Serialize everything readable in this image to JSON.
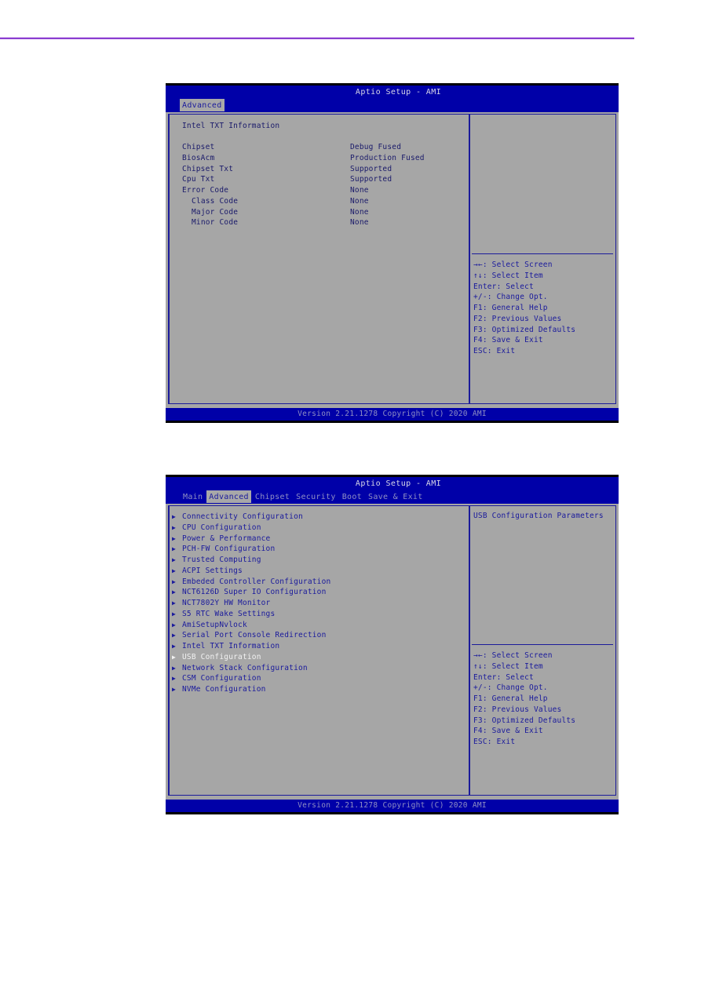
{
  "screens": [
    {
      "title": "Aptio Setup - AMI",
      "tabs": [
        {
          "label": "Advanced",
          "active": true
        }
      ],
      "heading": "Intel TXT Information",
      "rows": [
        {
          "label": "Chipset",
          "value": "Debug Fused",
          "indent": false
        },
        {
          "label": "BiosAcm",
          "value": "Production Fused",
          "indent": false
        },
        {
          "label": "Chipset Txt",
          "value": "Supported",
          "indent": false
        },
        {
          "label": "Cpu Txt",
          "value": "Supported",
          "indent": false
        },
        {
          "label": "Error Code",
          "value": "None",
          "indent": false
        },
        {
          "label": "Class Code",
          "value": "None",
          "indent": true
        },
        {
          "label": "Major Code",
          "value": "None",
          "indent": true
        },
        {
          "label": "Minor Code",
          "value": "None",
          "indent": true
        }
      ],
      "help_description": "",
      "keys": [
        "→←: Select Screen",
        "↑↓: Select Item",
        "Enter: Select",
        "+/-: Change Opt.",
        "F1: General Help",
        "F2: Previous Values",
        "F3: Optimized Defaults",
        "F4: Save & Exit",
        "ESC: Exit"
      ],
      "footer": "Version 2.21.1278 Copyright (C) 2020 AMI"
    },
    {
      "title": "Aptio Setup - AMI",
      "tabs": [
        {
          "label": "Main",
          "active": false
        },
        {
          "label": "Advanced",
          "active": true
        },
        {
          "label": "Chipset",
          "active": false
        },
        {
          "label": "Security",
          "active": false
        },
        {
          "label": "Boot",
          "active": false
        },
        {
          "label": "Save & Exit",
          "active": false
        }
      ],
      "menu": [
        {
          "label": "Connectivity Configuration",
          "selected": false
        },
        {
          "label": "CPU Configuration",
          "selected": false
        },
        {
          "label": "Power & Performance",
          "selected": false
        },
        {
          "label": "PCH-FW Configuration",
          "selected": false
        },
        {
          "label": "Trusted Computing",
          "selected": false
        },
        {
          "label": "ACPI Settings",
          "selected": false
        },
        {
          "label": "Embeded Controller Configuration",
          "selected": false
        },
        {
          "label": "NCT6126D Super IO Configuration",
          "selected": false
        },
        {
          "label": "NCT7802Y HW Monitor",
          "selected": false
        },
        {
          "label": "S5 RTC Wake Settings",
          "selected": false
        },
        {
          "label": "AmiSetupNvlock",
          "selected": false
        },
        {
          "label": "Serial Port Console Redirection",
          "selected": false
        },
        {
          "label": "Intel TXT Information",
          "selected": false
        },
        {
          "label": "USB Configuration",
          "selected": true
        },
        {
          "label": "Network Stack Configuration",
          "selected": false
        },
        {
          "label": "CSM Configuration",
          "selected": false
        },
        {
          "label": "NVMe Configuration",
          "selected": false
        }
      ],
      "help_description": "USB Configuration Parameters",
      "keys": [
        "→←: Select Screen",
        "↑↓: Select Item",
        "Enter: Select",
        "+/-: Change Opt.",
        "F1: General Help",
        "F2: Previous Values",
        "F3: Optimized Defaults",
        "F4: Save & Exit",
        "ESC: Exit"
      ],
      "footer": "Version 2.21.1278 Copyright (C) 2020 AMI"
    }
  ],
  "icons": {
    "submenu_arrow": "▶"
  },
  "colors": {
    "bios_blue": "#0000a8",
    "panel_gray": "#a6a6a6",
    "text_blue": "#1a1a9c",
    "selected_white": "#f2f2f2",
    "page_rule_purple": "#8a3fd0"
  }
}
